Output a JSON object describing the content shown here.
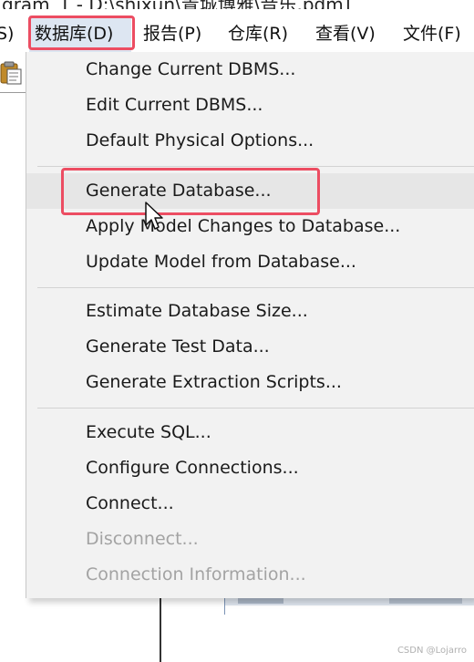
{
  "window": {
    "title_partial": "gram_1 - D:\\shixun\\青城博雅\\音乐.pdm]"
  },
  "menubar": {
    "items": [
      {
        "label": "S)"
      },
      {
        "label": "数据库(D)"
      },
      {
        "label": "报告(P)"
      },
      {
        "label": "仓库(R)"
      },
      {
        "label": "查看(V)"
      },
      {
        "label": "文件(F)"
      }
    ],
    "active_index": 1
  },
  "menu": {
    "groups": [
      {
        "items": [
          {
            "label": "Change Current DBMS...",
            "enabled": true
          },
          {
            "label": "Edit Current DBMS...",
            "enabled": true
          },
          {
            "label": "Default Physical Options...",
            "enabled": true
          }
        ]
      },
      {
        "items": [
          {
            "label": "Generate Database...",
            "enabled": true,
            "hovered": true
          },
          {
            "label": "Apply Model Changes to Database...",
            "enabled": true
          },
          {
            "label": "Update Model from Database...",
            "enabled": true
          }
        ]
      },
      {
        "items": [
          {
            "label": "Estimate Database Size...",
            "enabled": true
          },
          {
            "label": "Generate Test Data...",
            "enabled": true
          },
          {
            "label": "Generate Extraction Scripts...",
            "enabled": true
          }
        ]
      },
      {
        "items": [
          {
            "label": "Execute SQL...",
            "enabled": true
          },
          {
            "label": "Configure Connections...",
            "enabled": true
          },
          {
            "label": "Connect...",
            "enabled": true
          },
          {
            "label": "Disconnect...",
            "enabled": false
          },
          {
            "label": "Connection Information...",
            "enabled": false
          }
        ]
      }
    ]
  },
  "annotations": {
    "highlight_color": "#ec4d62"
  },
  "watermark": "CSDN @Lojarro",
  "colors": {
    "menu_bg": "#f2f2f2",
    "hover_bg": "#e6e6e6",
    "disabled_text": "#a3a3a3",
    "menubar_active_bg": "#dde6f2"
  }
}
